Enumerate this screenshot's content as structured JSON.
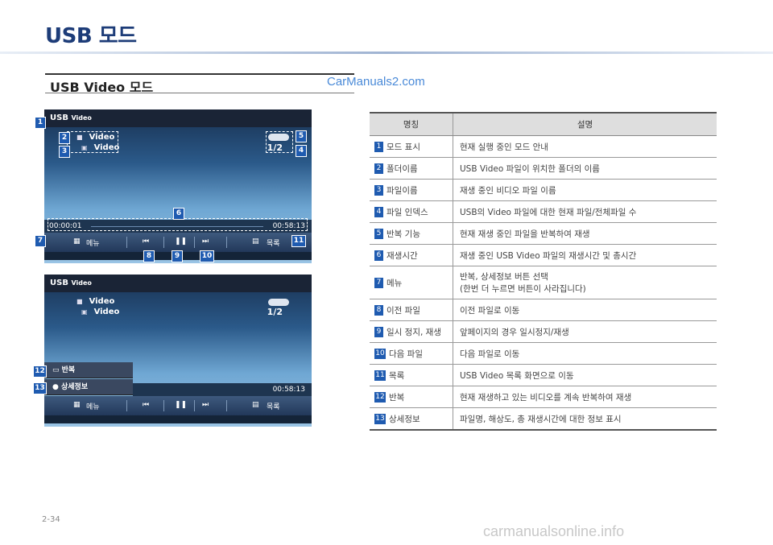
{
  "page_title": "USB 모드",
  "section_title": "USB Video 모드",
  "watermark_top": "CarManuals2.com",
  "watermark_bottom": "carmanualsonline.info",
  "page_number": "2-34",
  "screen1": {
    "header": "USB",
    "header_sub": "Video",
    "folder": "Video",
    "file": "Video",
    "index": "1/2",
    "time_elapsed": "00:00:01",
    "time_total": "00:58:13",
    "menu": "메뉴",
    "list": "목록"
  },
  "screen2": {
    "header": "USB",
    "header_sub": "Video",
    "folder": "Video",
    "file": "Video",
    "index": "1/2",
    "time_total": "00:58:13",
    "menu": "메뉴",
    "list": "목록",
    "popup_repeat": "반복",
    "popup_info": "상세정보"
  },
  "badges": [
    "1",
    "2",
    "3",
    "4",
    "5",
    "6",
    "7",
    "8",
    "9",
    "10",
    "11",
    "12",
    "13"
  ],
  "table": {
    "headers": [
      "명칭",
      "설명"
    ],
    "rows": [
      {
        "num": "1",
        "name": "모드 표시",
        "desc": "현재 실행 중인 모드 안내"
      },
      {
        "num": "2",
        "name": "폴더이름",
        "desc": "USB Video 파일이 위치한 폴더의 이름"
      },
      {
        "num": "3",
        "name": "파일이름",
        "desc": "재생 중인 비디오 파일 이름"
      },
      {
        "num": "4",
        "name": "파일 인덱스",
        "desc": "USB의 Video 파일에 대한 현재 파일/전체파일 수"
      },
      {
        "num": "5",
        "name": "반복 기능",
        "desc": "현재 재생 중인 파일을 반복하여 재생"
      },
      {
        "num": "6",
        "name": "재생시간",
        "desc": "재생 중인 USB Video 파일의 재생시간 및 총시간"
      },
      {
        "num": "7",
        "name": "메뉴",
        "desc": "반복, 상세정보 버튼 선택",
        "desc2": "(한번 더 누르면 버튼이 사라집니다)"
      },
      {
        "num": "8",
        "name": "이전 파일",
        "desc": "이전 파일로 이동"
      },
      {
        "num": "9",
        "name": "일시 정지, 재생",
        "desc": "앞페이지의 경우 일시정지/재생"
      },
      {
        "num": "10",
        "name": "다음 파일",
        "desc": "다음 파일로 이동"
      },
      {
        "num": "11",
        "name": "목록",
        "desc": "USB Video 목록 화면으로 이동"
      },
      {
        "num": "12",
        "name": "반복",
        "desc": "현재 재생하고 있는 비디오를 계속 반복하여 재생"
      },
      {
        "num": "13",
        "name": "상세정보",
        "desc": "파일명, 해상도, 총 재생시간에 대한 정보 표시"
      }
    ]
  },
  "colors": {
    "accent": "#1f5bb0",
    "title": "#1d3c78"
  }
}
